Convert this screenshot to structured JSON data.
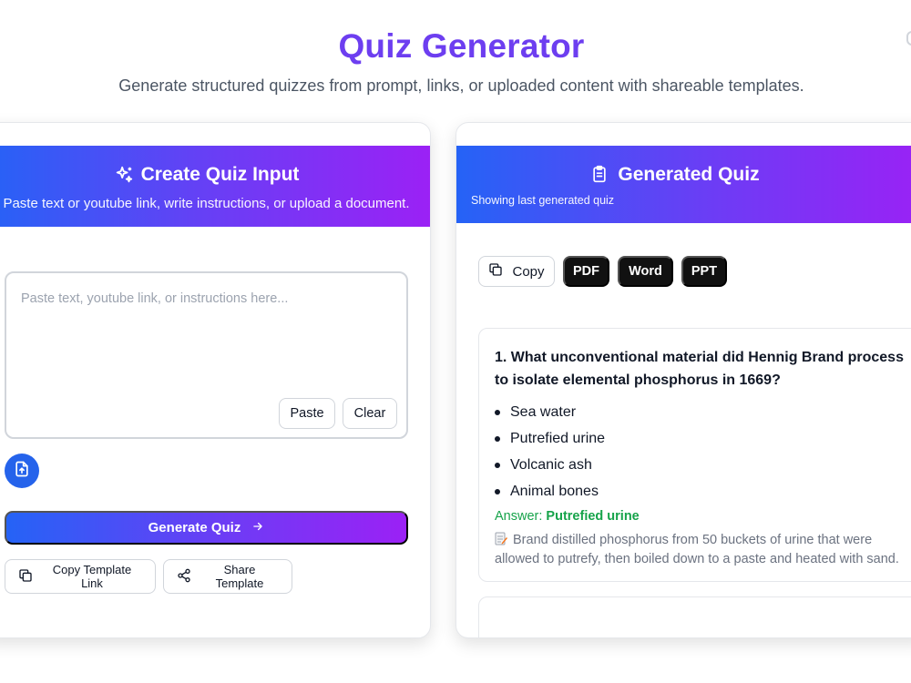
{
  "header": {
    "title": "Quiz Generator",
    "subtitle": "Generate structured quizzes from prompt, links, or uploaded content with shareable templates."
  },
  "input_panel": {
    "title": "Create Quiz Input",
    "subtitle": "Paste text or youtube link, write instructions, or upload a document.",
    "icon": "sparkles-icon",
    "textarea": {
      "value": "",
      "placeholder": "Paste text, youtube link, or instructions here..."
    },
    "paste_label": "Paste",
    "clear_label": "Clear",
    "upload_icon": "file-upload-icon",
    "generate_label": "Generate Quiz",
    "copy_template_label": "Copy Template Link",
    "share_template_label": "Share Template"
  },
  "output_panel": {
    "title": "Generated Quiz",
    "subtitle": "Showing last generated quiz",
    "icon": "clipboard-icon",
    "toolbar": {
      "copy_label": "Copy",
      "pdf_label": "PDF",
      "word_label": "Word",
      "ppt_label": "PPT"
    },
    "questions": [
      {
        "title": "1. What unconventional material did Hennig Brand process to isolate elemental phosphorus in 1669?",
        "options": [
          "Sea water",
          "Putrefied urine",
          "Volcanic ash",
          "Animal bones"
        ],
        "answer_prefix": "Answer:",
        "answer": "Putrefied urine",
        "explanation": "Brand distilled phosphorus from 50 buckets of urine that were allowed to putrefy, then boiled down to a paste and heated with sand."
      }
    ]
  },
  "colors": {
    "accent_purple": "#6d3ef0",
    "gradient_start": "#2563f6",
    "gradient_end": "#9b21f5",
    "answer_green": "#16a34a",
    "upload_blue": "#2563eb"
  }
}
